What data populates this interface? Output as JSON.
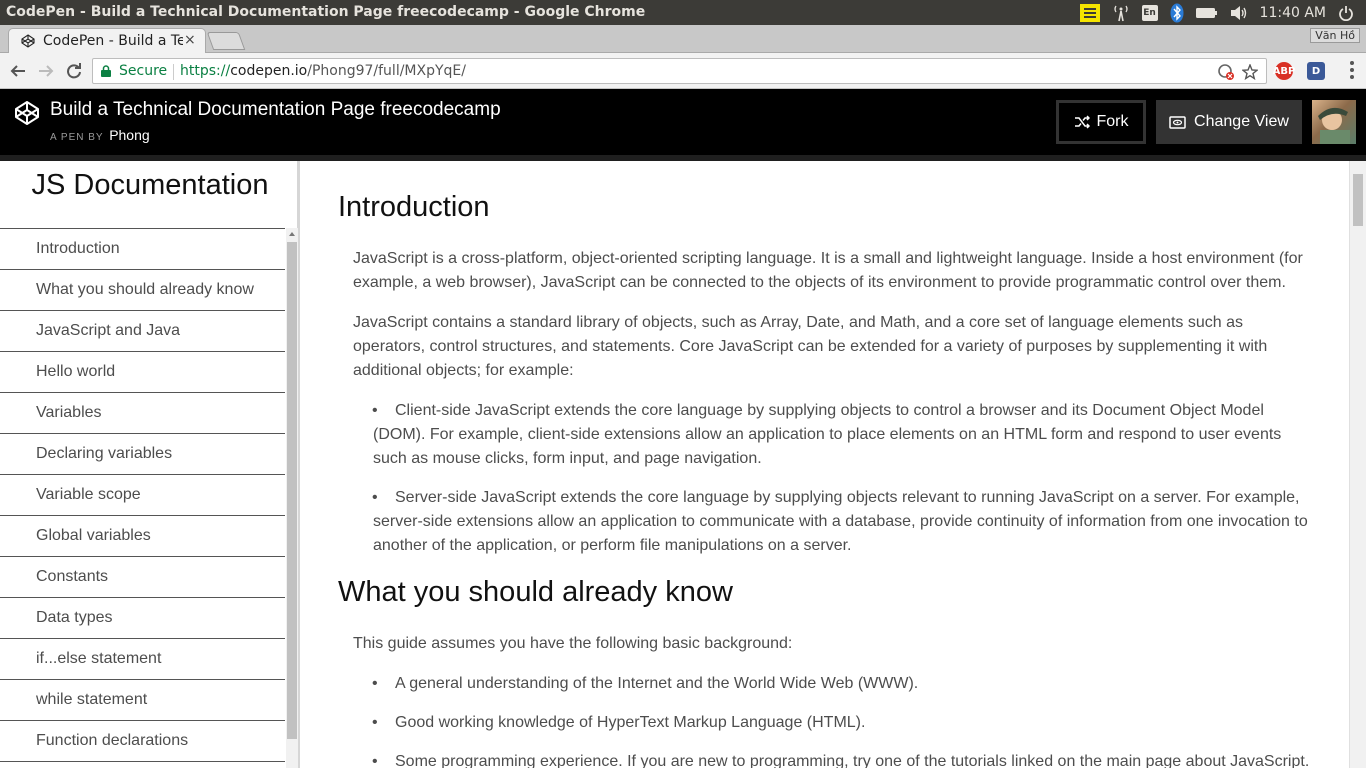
{
  "window": {
    "title": "CodePen - Build a Technical Documentation Page freecodecamp - Google Chrome"
  },
  "os_tray": {
    "keyboard": "En",
    "time": "11:40 AM"
  },
  "tab": {
    "label": "CodePen - Build a Te",
    "close": "×"
  },
  "profile": {
    "name": "Văn Hồ"
  },
  "omnibox": {
    "secure": "Secure",
    "url_scheme": "https://",
    "url_host": "codepen.io",
    "url_path": "/Phong97/full/MXpYqE/"
  },
  "extensions": {
    "abp": "ABP",
    "d": "D"
  },
  "codepen": {
    "title": "Build a Technical Documentation Page freecodecamp",
    "byline_prefix": "A PEN BY",
    "author": "Phong",
    "fork_label": "Fork",
    "change_view_label": "Change View"
  },
  "nav": {
    "header": "JS Documentation",
    "links": [
      "Introduction",
      "What you should already know",
      "JavaScript and Java",
      "Hello world",
      "Variables",
      "Declaring variables",
      "Variable scope",
      "Global variables",
      "Constants",
      "Data types",
      "if...else statement",
      "while statement",
      "Function declarations"
    ]
  },
  "sections": {
    "intro": {
      "title": "Introduction",
      "p1": "JavaScript is a cross-platform, object-oriented scripting language. It is a small and lightweight language. Inside a host environment (for example, a web browser), JavaScript can be connected to the objects of its environment to provide programmatic control over them.",
      "p2": "JavaScript contains a standard library of objects, such as Array, Date, and Math, and a core set of language elements such as operators, control structures, and statements. Core JavaScript can be extended for a variety of purposes by supplementing it with additional objects; for example:",
      "b1": "Client-side JavaScript extends the core language by supplying objects to control a browser and its Document Object Model (DOM). For example, client-side extensions allow an application to place elements on an HTML form and respond to user events such as mouse clicks, form input, and page navigation.",
      "b2": "Server-side JavaScript extends the core language by supplying objects relevant to running JavaScript on a server. For example, server-side extensions allow an application to communicate with a database, provide continuity of information from one invocation to another of the application, or perform file manipulations on a server."
    },
    "know": {
      "title": "What you should already know",
      "p1": "This guide assumes you have the following basic background:",
      "b1": "A general understanding of the Internet and the World Wide Web (WWW).",
      "b2": "Good working knowledge of HyperText Markup Language (HTML).",
      "b3": "Some programming experience. If you are new to programming, try one of the tutorials linked on the main page about JavaScript."
    }
  },
  "colors": {
    "secure_green": "#0b8043",
    "header_bg": "#000000",
    "text": "#4d4d4d"
  }
}
